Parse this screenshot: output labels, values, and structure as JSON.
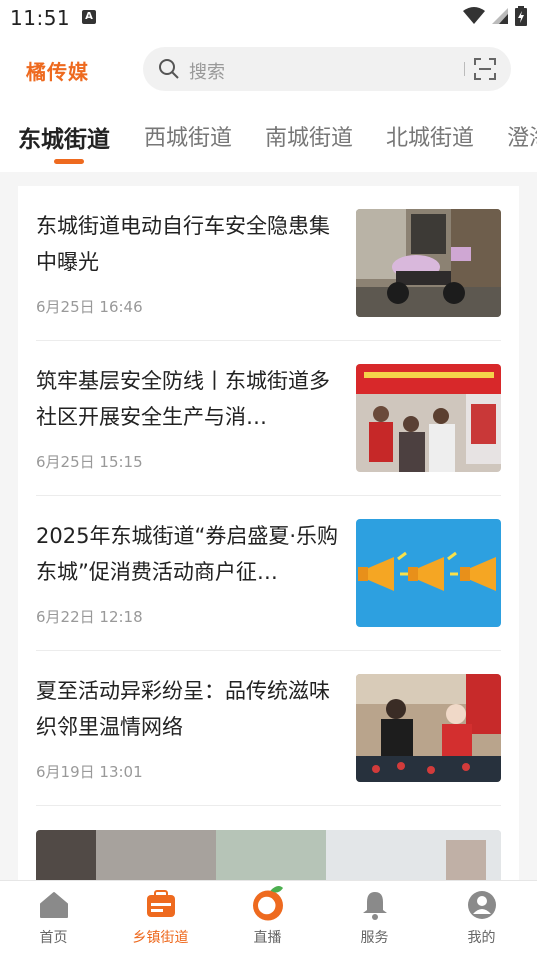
{
  "status_bar": {
    "time": "11:51",
    "indicator": "A"
  },
  "header": {
    "logo": "橘传媒",
    "search_placeholder": "搜索"
  },
  "tabs": [
    {
      "label": "东城街道",
      "active": true
    },
    {
      "label": "西城街道"
    },
    {
      "label": "南城街道"
    },
    {
      "label": "北城街道"
    },
    {
      "label": "澄海"
    }
  ],
  "news": [
    {
      "title": "东城街道电动自行车安全隐患集中曝光",
      "date": "6月25日 16:46",
      "thumb_icon": "electric-bike-image"
    },
    {
      "title": "筑牢基层安全防线丨东城街道多社区开展安全生产与消…",
      "date": "6月25日 15:15",
      "thumb_icon": "safety-event-image"
    },
    {
      "title": "2025年东城街道“券启盛夏·乐购东城”促消费活动商户征…",
      "date": "6月22日 12:18",
      "thumb_icon": "megaphone-image"
    },
    {
      "title": "夏至活动异彩纷呈：品传统滋味 织邻里温情网络",
      "date": "6月19日 13:01",
      "thumb_icon": "community-event-image"
    }
  ],
  "bottom_nav": [
    {
      "label": "首页",
      "icon": "home-icon"
    },
    {
      "label": "乡镇街道",
      "icon": "town-icon",
      "active": true
    },
    {
      "label": "直播",
      "icon": "live-icon"
    },
    {
      "label": "服务",
      "icon": "bell-icon"
    },
    {
      "label": "我的",
      "icon": "profile-icon"
    }
  ],
  "colors": {
    "accent": "#ee6a1f",
    "text": "#222222",
    "muted": "#999999",
    "background": "#f5f5f5"
  }
}
